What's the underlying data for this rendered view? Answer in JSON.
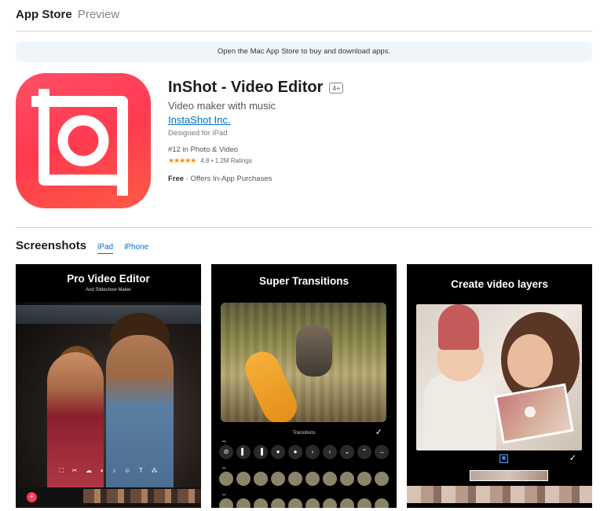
{
  "header": {
    "brand": "App Store",
    "sub": "Preview"
  },
  "banner": {
    "text": "Open the Mac App Store to buy and download apps."
  },
  "app": {
    "name": "InShot - Video Editor",
    "age_rating": "4+",
    "subtitle": "Video maker with music",
    "developer": "InstaShot Inc.",
    "designed_for": "Designed for iPad",
    "rank": "#12 in Photo & Video",
    "stars": "★★★★★",
    "rating_text": "4.8 • 1.2M Ratings",
    "price": "Free",
    "price_note": " · Offers In-App Purchases",
    "icon_colors": {
      "gradient_start": "#ff4f68",
      "gradient_end": "#ff5a44",
      "frame": "#ffffff"
    }
  },
  "screenshots": {
    "title": "Screenshots",
    "tabs": [
      {
        "label": "iPad",
        "active": true
      },
      {
        "label": "iPhone",
        "active": false
      }
    ],
    "items": [
      {
        "caption": "Pro Video Editor",
        "subcaption": "And Slideshow Maker"
      },
      {
        "caption": "Super Transitions",
        "panel_label": "Transitions"
      },
      {
        "caption": "Create video layers"
      }
    ]
  }
}
